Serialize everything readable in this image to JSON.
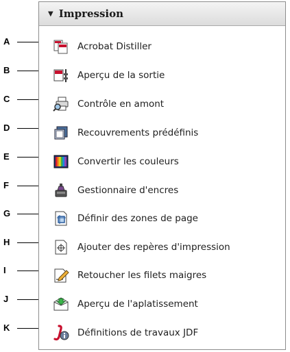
{
  "panel": {
    "title": "Impression",
    "items": [
      {
        "key": "A",
        "label": "Acrobat Distiller",
        "icon": "acrobat-distiller-icon"
      },
      {
        "key": "B",
        "label": "Aperçu de la sortie",
        "icon": "output-preview-icon"
      },
      {
        "key": "C",
        "label": "Contrôle en amont",
        "icon": "preflight-icon"
      },
      {
        "key": "D",
        "label": "Recouvrements prédéfinis",
        "icon": "trap-presets-icon"
      },
      {
        "key": "E",
        "label": "Convertir les couleurs",
        "icon": "convert-colors-icon"
      },
      {
        "key": "F",
        "label": "Gestionnaire d'encres",
        "icon": "ink-manager-icon"
      },
      {
        "key": "G",
        "label": "Définir des zones de page",
        "icon": "page-boxes-icon"
      },
      {
        "key": "H",
        "label": "Ajouter des repères d'impression",
        "icon": "printer-marks-icon"
      },
      {
        "key": "I",
        "label": "Retoucher les filets maigres",
        "icon": "fix-hairlines-icon"
      },
      {
        "key": "J",
        "label": "Aperçu de l'aplatissement",
        "icon": "flattener-preview-icon"
      },
      {
        "key": "K",
        "label": "Définitions de travaux JDF",
        "icon": "jdf-definitions-icon"
      }
    ]
  },
  "colors": {
    "panel_border": "#8c8c8c",
    "header_bg": "#dcdcdc",
    "accent_red": "#c8102e"
  }
}
